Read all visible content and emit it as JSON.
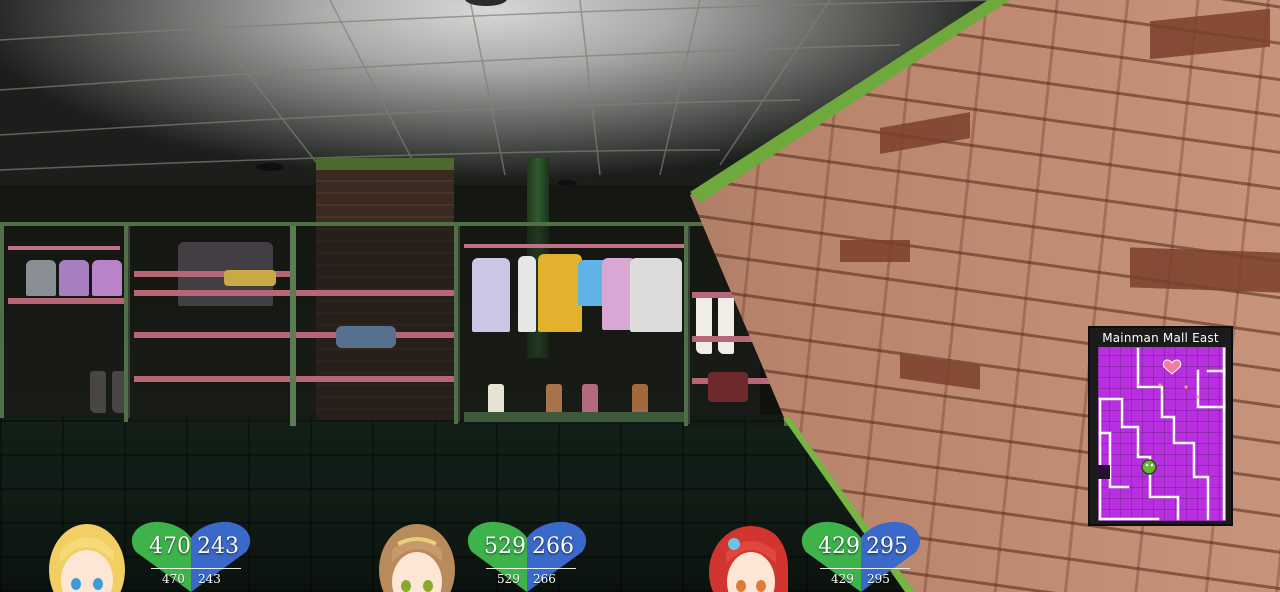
{
  "location": {
    "name": "Mainman Mall East"
  },
  "minimap": {
    "colors": {
      "floor": "#b82fe0",
      "walls": "#ffffff",
      "player": "#69b33b",
      "marker": "#f47aa0"
    }
  },
  "party": [
    {
      "hp": "470",
      "mp": "243",
      "hp_max": "470",
      "mp_max": "243",
      "portrait": "blonde-girl-portrait",
      "hair_color": "#f2cf63"
    },
    {
      "hp": "529",
      "mp": "266",
      "hp_max": "529",
      "mp_max": "266",
      "portrait": "brunette-girl-portrait",
      "hair_color": "#b98a5c"
    },
    {
      "hp": "429",
      "mp": "295",
      "hp_max": "429",
      "mp_max": "295",
      "portrait": "redhead-girl-portrait",
      "hair_color": "#d2352f"
    }
  ],
  "colors": {
    "hp_heart": "#3db34a",
    "mp_heart": "#3b69c9",
    "wall_trim": "#6fa83d"
  }
}
